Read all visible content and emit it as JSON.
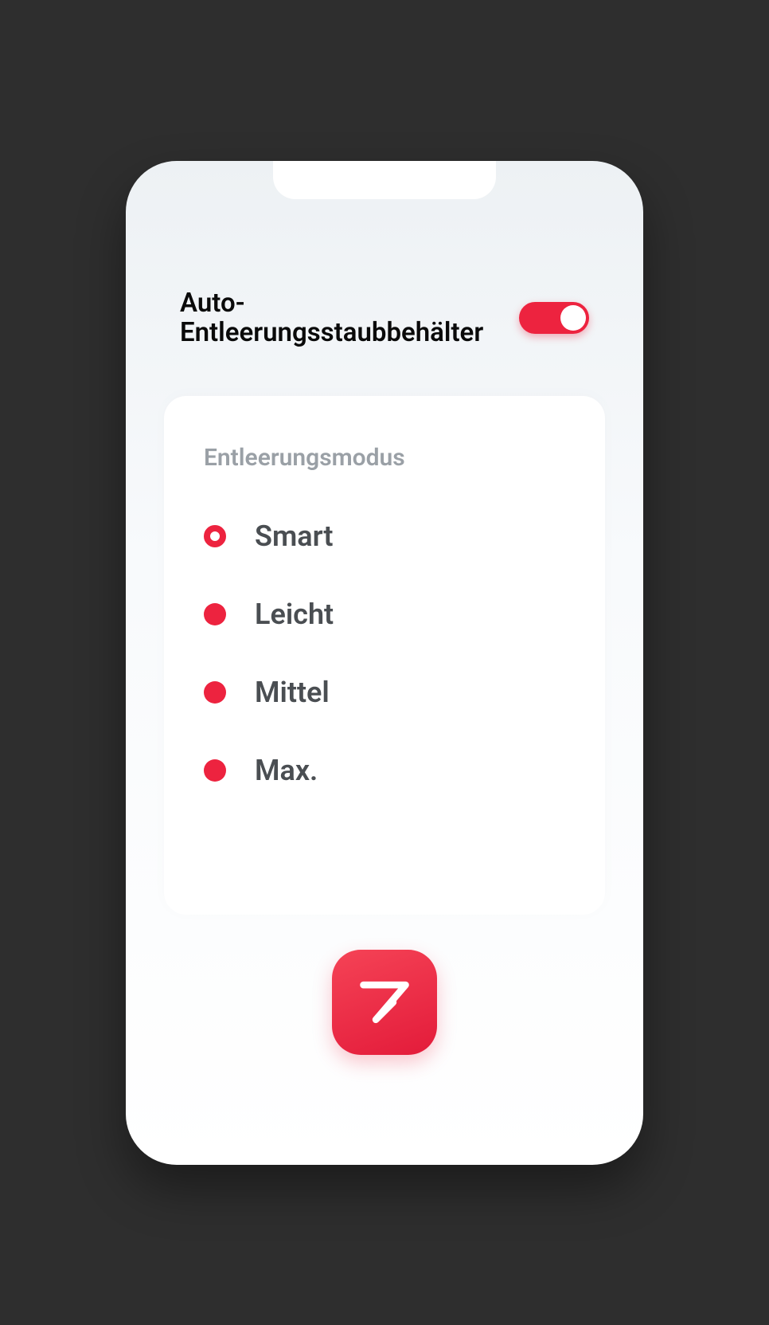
{
  "header": {
    "title": "Auto-Entleerungsstaubbehälter",
    "toggle_on": true
  },
  "card": {
    "heading": "Entleerungsmodus",
    "options": [
      {
        "label": "Smart",
        "selected": true
      },
      {
        "label": "Leicht",
        "selected": false
      },
      {
        "label": "Mittel",
        "selected": false
      },
      {
        "label": "Max.",
        "selected": false
      }
    ]
  },
  "colors": {
    "accent": "#ed233f"
  }
}
